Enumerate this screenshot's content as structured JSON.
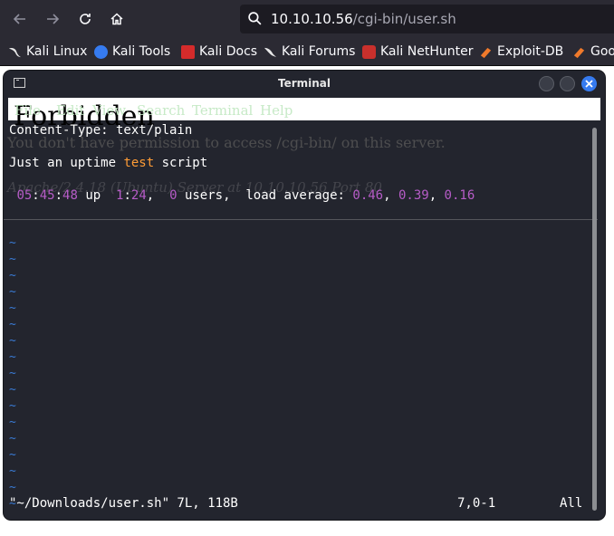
{
  "browser": {
    "url_host": "10.10.10.56",
    "url_path": "/cgi-bin/user.sh",
    "bookmarks": [
      {
        "label": "Kali Linux",
        "icon": "kali-dragon-icon"
      },
      {
        "label": "Kali Tools",
        "icon": "kali-tools-icon"
      },
      {
        "label": "Kali Docs",
        "icon": "kali-docs-icon"
      },
      {
        "label": "Kali Forums",
        "icon": "kali-forums-icon"
      },
      {
        "label": "Kali NetHunter",
        "icon": "nethunter-icon"
      },
      {
        "label": "Exploit-DB",
        "icon": "exploit-db-icon"
      },
      {
        "label": "Goo",
        "icon": "exploit-db-icon"
      }
    ]
  },
  "page_behind": {
    "heading": "Forbidden",
    "message": "You don't have permission to access /cgi-bin/ on this server.",
    "footer": "Apache/2.4.18 (Ubuntu) Server at 10.10.10.56 Port 80"
  },
  "terminal": {
    "title": "Terminal",
    "menu": [
      "File",
      "Edit",
      "View",
      "Search",
      "Terminal",
      "Help"
    ],
    "content_type_line": "Content-Type: text/plain",
    "script_line": {
      "before": "Just an uptime ",
      "keyword": "test",
      "after": " script"
    },
    "uptime": {
      "time_h": "05",
      "time_m": "45",
      "time_s": "48",
      "up_text": " up  ",
      "dur_h": "1",
      "dur_m": "24",
      "users_num": "0",
      "users_text": " users,  load average: ",
      "load1": "0.46",
      "load5": "0.39",
      "load15": "0.16"
    },
    "tilde_char": "~",
    "tilde_count": 17,
    "status_file": "\"~/Downloads/user.sh\" 7L, 118B",
    "status_pos": "7,0-1",
    "status_scroll": "All"
  },
  "colors": {
    "number": "#b65cc7",
    "keyword": "#ff9c36",
    "tilde": "#3a7bd5",
    "accent": "#367bf0"
  }
}
